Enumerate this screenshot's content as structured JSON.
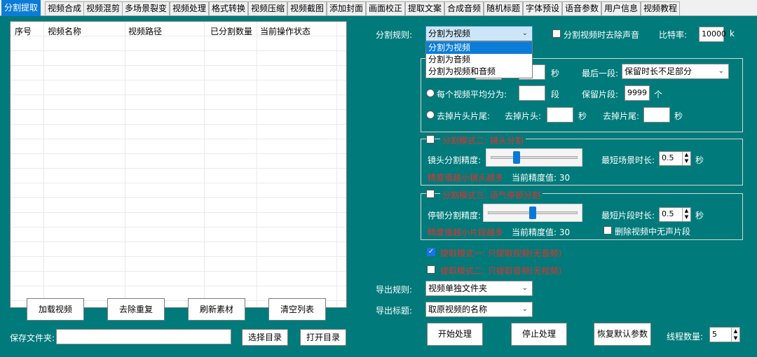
{
  "tabs": [
    "分割提取",
    "视频合成",
    "视频混剪",
    "多场景裂变",
    "视频处理",
    "格式转换",
    "视频压缩",
    "视频截图",
    "添加封面",
    "画面校正",
    "提取文案",
    "合成音频",
    "随机标题",
    "字体预设",
    "语音参数",
    "用户信息",
    "视频教程"
  ],
  "table": {
    "headers": [
      "序号",
      "视频名称",
      "视频路径",
      "已分割数量",
      "当前操作状态"
    ]
  },
  "left_buttons": {
    "load": "加载视频",
    "dedupe": "去除重复",
    "refresh": "刷新素材",
    "clear": "清空列表",
    "save_folder_label": "保存文件夹:",
    "save_folder_value": "",
    "choose_dir": "选择目录",
    "open_dir": "打开目录"
  },
  "split_rule": {
    "label": "分割规则:",
    "value": "分割为视频",
    "options": [
      "分割为视频",
      "分割为音频",
      "分割为视频和音频"
    ],
    "remove_sound_label": "分割视频时去除声音",
    "bitrate_label": "比特率:",
    "bitrate_value": "10000",
    "bitrate_unit": "k"
  },
  "mode1": {
    "seconds_unit": "秒",
    "last_segment_label": "最后一段:",
    "last_segment_value": "保留时长不足部分",
    "avg_label": "每个视频平均分为:",
    "avg_unit": "段",
    "keep_label": "保留片段:",
    "keep_value": "9999",
    "keep_unit": "个",
    "trim_label": "去掉片头片尾:",
    "trim_head_label": "去掉片头:",
    "trim_head_unit": "秒",
    "trim_tail_label": "去掉片尾:",
    "trim_tail_unit": "秒"
  },
  "mode2": {
    "title": "分割模式二: 镜头分割",
    "precision_label": "镜头分割精度:",
    "min_scene_label": "最短场景时长:",
    "min_scene_value": "0.5",
    "min_scene_unit": "秒",
    "hint": "精度值越小镜头越多",
    "current_label": "当前精度值: 30",
    "slider_level": 0.3
  },
  "mode3": {
    "title": "分割模式三: 语气停顿分割",
    "precision_label": "停顿分割精度:",
    "min_clip_label": "最短片段时长:",
    "min_clip_value": "0.5",
    "min_clip_unit": "秒",
    "hint": "精度值越小片段越多",
    "current_label": "当前精度值: 30",
    "remove_silent_label": "删除视频中无声片段",
    "slider_level": 0.5
  },
  "extract": {
    "mode1": "提取模式一: 只提取视频(无音频)",
    "mode1_checked": true,
    "mode2": "提取模式二: 只提取音频(无视频)",
    "mode2_checked": false
  },
  "export": {
    "rule_label": "导出规则:",
    "rule_value": "视频单独文件夹",
    "title_label": "导出标题:",
    "title_value": "取原视频的名称"
  },
  "actions": {
    "start": "开始处理",
    "stop": "停止处理",
    "restore": "恢复默认参数",
    "threads_label": "线程数量:",
    "threads_value": "5"
  },
  "colors": {
    "panel": "#007a7a",
    "accent": "#0b7dd8",
    "warning": "#e5322a"
  }
}
